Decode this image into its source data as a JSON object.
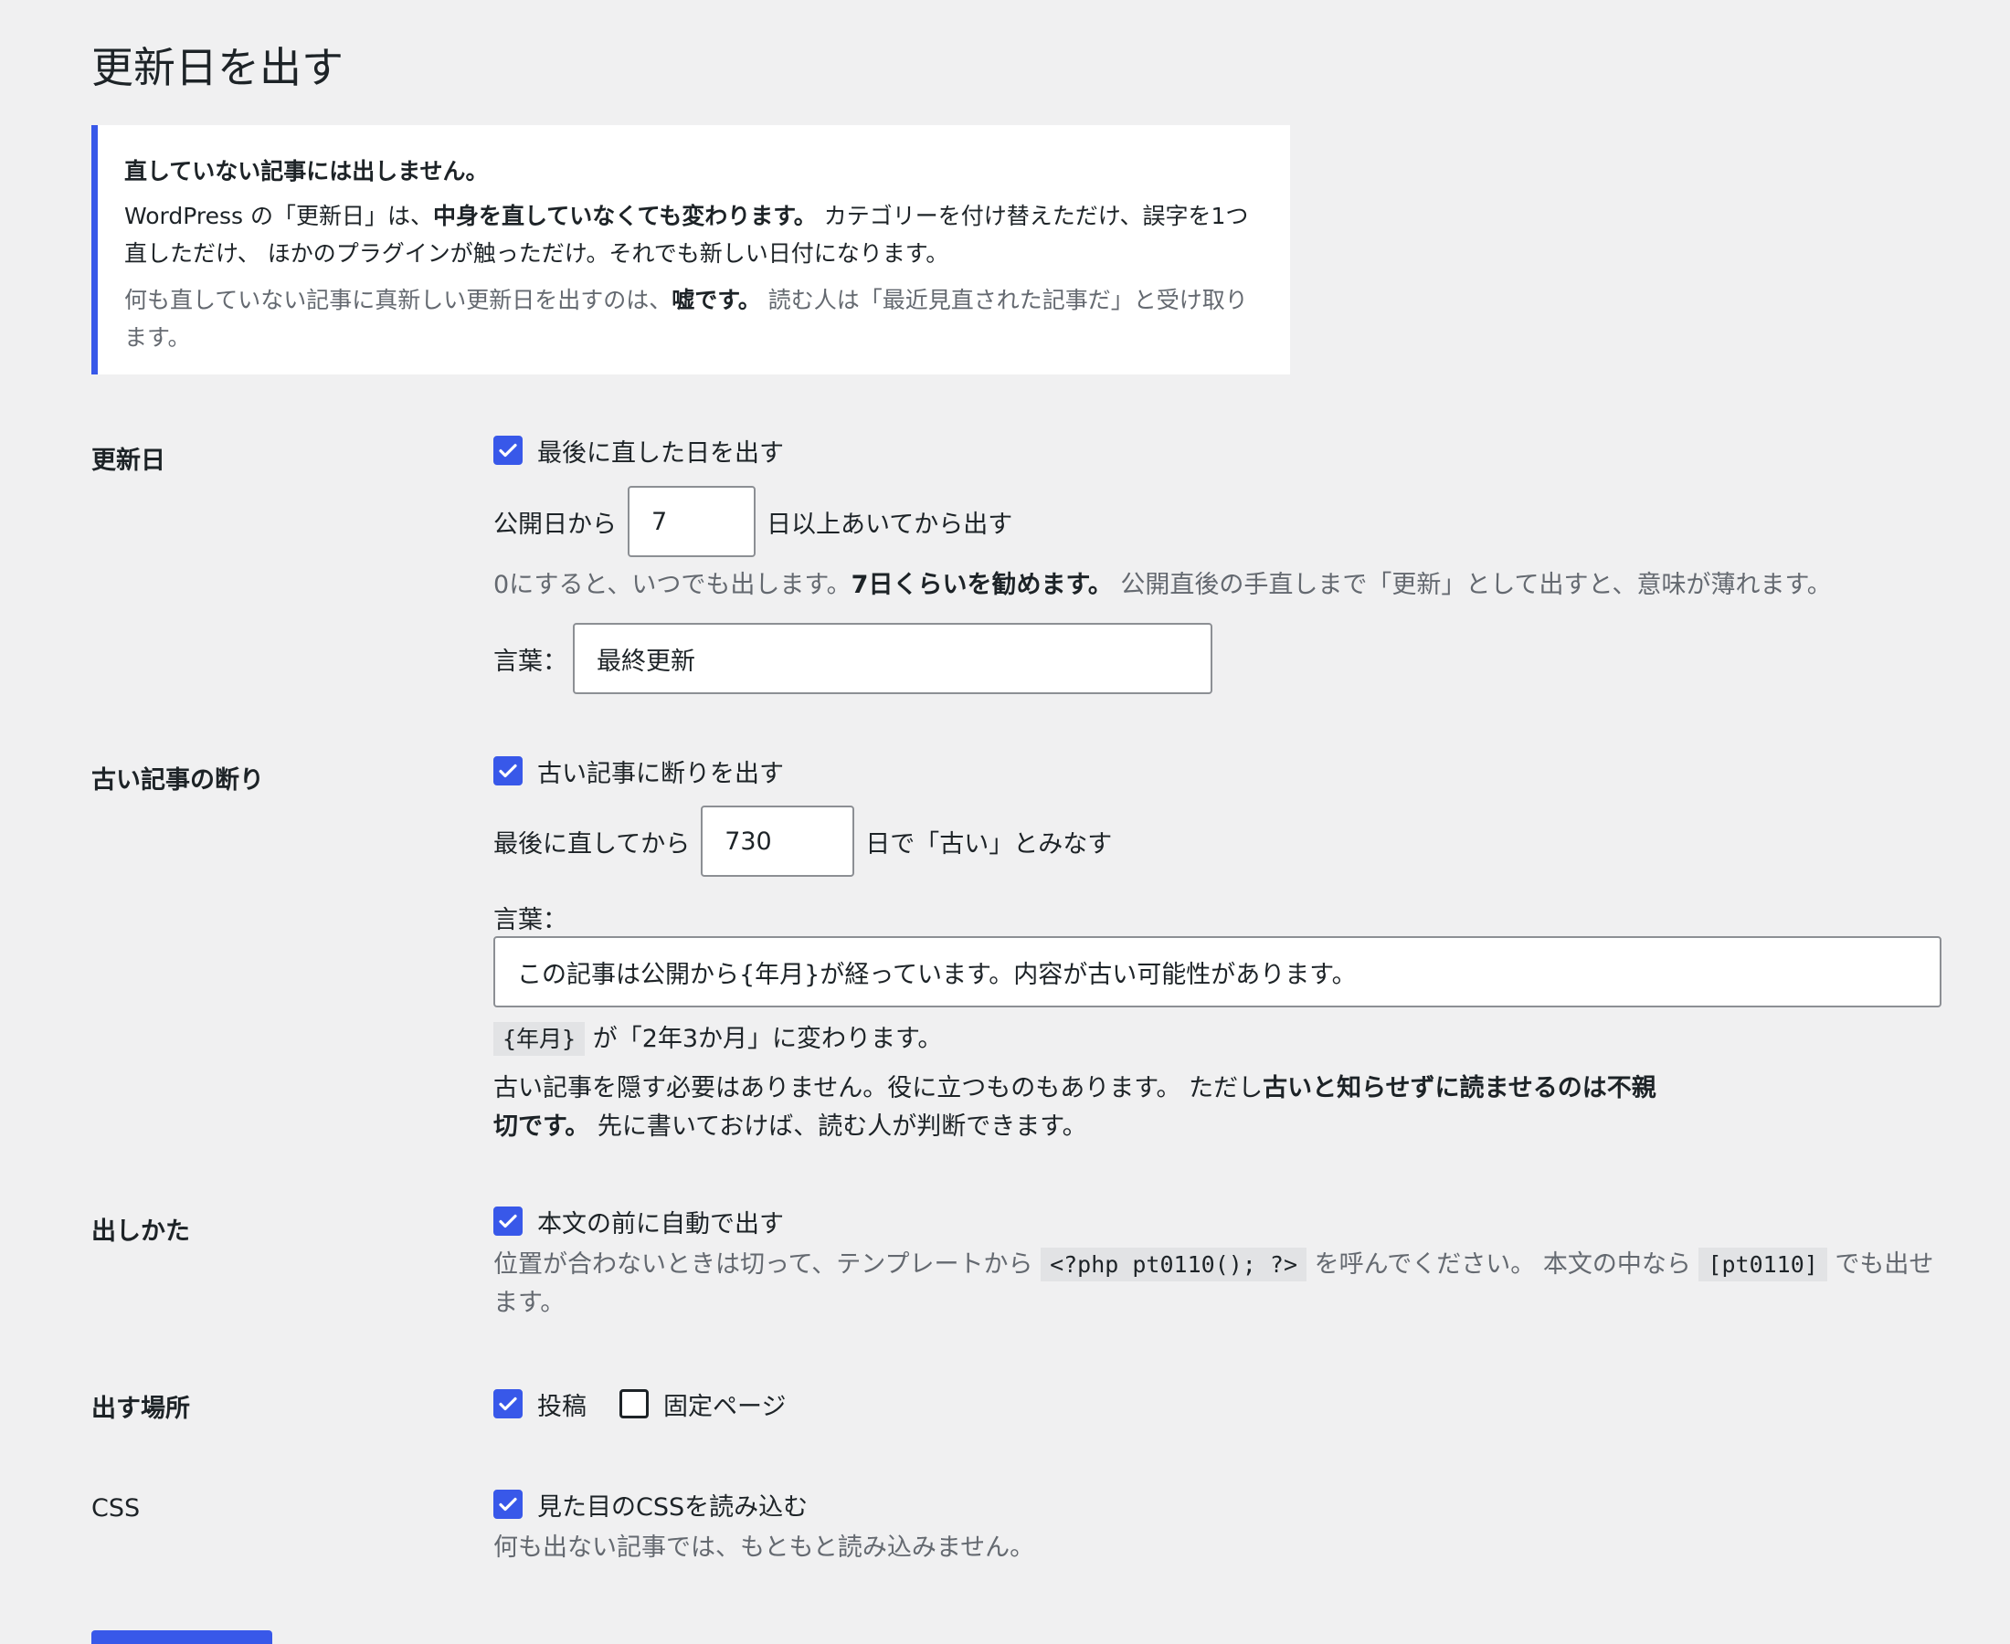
{
  "page": {
    "title": "更新日を出す"
  },
  "notice": {
    "title": "直していない記事には出しません。",
    "body_1": "WordPress の「更新日」は、",
    "body_strong": "中身を直していなくても変わります。",
    "body_2": " カテゴリーを付け替えただけ、誤字を1つ直しただけ、 ほかのプラグインが触っただけ。それでも新しい日付になります。",
    "sub_1": "何も直していない記事に真新しい更新日を出すのは、",
    "sub_strong": "嘘です。",
    "sub_2": " 読む人は「最近見直された記事だ」と受け取ります。"
  },
  "updated": {
    "label": "更新日",
    "checkbox_label": "最後に直した日を出す",
    "checked": true,
    "days_prefix": "公開日から",
    "days_value": "7",
    "days_suffix": "日以上あいてから出す",
    "desc_1": "0にすると、いつでも出します。",
    "desc_strong": "7日くらいを勧めます。",
    "desc_2": " 公開直後の手直しまで「更新」として出すと、意味が薄れます。",
    "word_label": "言葉：",
    "word_value": "最終更新"
  },
  "old": {
    "label": "古い記事の断り",
    "checkbox_label": "古い記事に断りを出す",
    "checked": true,
    "days_prefix": "最後に直してから",
    "days_value": "730",
    "days_suffix": "日で「古い」とみなす",
    "word_label": "言葉：",
    "word_value": "この記事は公開から{年月}が経っています。内容が古い可能性があります。",
    "token": "{年月}",
    "token_desc": " が「2年3か月」に変わります。",
    "body_1": "古い記事を隠す必要はありません。役に立つものもあります。 ただし",
    "body_strong": "古いと知らせずに読ませるのは不親切です。",
    "body_2": " 先に書いておけば、読む人が判断できます。"
  },
  "placement": {
    "label": "出しかた",
    "checkbox_label": "本文の前に自動で出す",
    "checked": true,
    "desc_1": "位置が合わないときは切って、テンプレートから ",
    "code_1": "<?php pt0110(); ?>",
    "desc_2": " を呼んでください。 本文の中なら ",
    "code_2": "[pt0110]",
    "desc_3": " でも出せます。"
  },
  "location": {
    "label": "出す場所",
    "options": [
      {
        "label": "投稿",
        "checked": true
      },
      {
        "label": "固定ページ",
        "checked": false
      }
    ]
  },
  "css": {
    "label": "CSS",
    "checkbox_label": "見た目のCSSを読み込む",
    "checked": true,
    "desc": "何も出ない記事では、もともと読み込みません。"
  },
  "colors": {
    "accent": "#3858e9",
    "background": "#f0f0f1",
    "muted": "#646970"
  }
}
